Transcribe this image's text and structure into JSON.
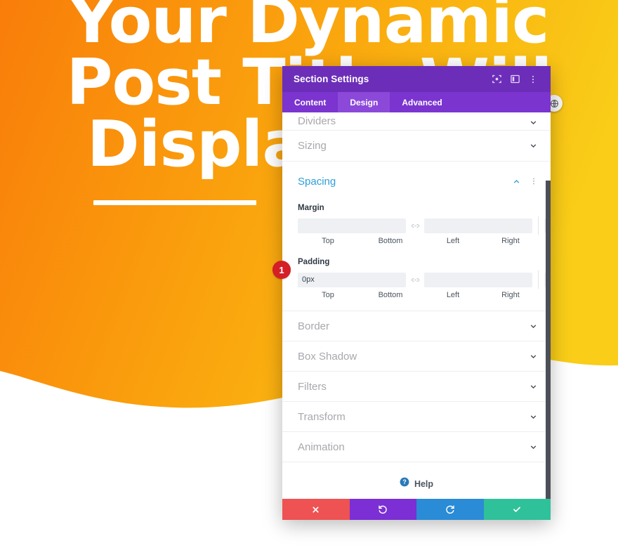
{
  "hero": {
    "lines": [
      "Your Dynamic",
      "Post Title Will",
      "Display Here"
    ],
    "rule": "horizontal-rule",
    "gradient": {
      "from": "#f97d0a",
      "to": "#f9cd18"
    }
  },
  "panel": {
    "title": "Section Settings",
    "header_icons": [
      {
        "name": "focus-icon",
        "glyph": "focus"
      },
      {
        "name": "layout-panel-icon",
        "glyph": "panel"
      },
      {
        "name": "more-vertical-icon",
        "glyph": "dots"
      }
    ],
    "tabs": [
      {
        "label": "Content",
        "active": false
      },
      {
        "label": "Design",
        "active": true
      },
      {
        "label": "Advanced",
        "active": false
      }
    ],
    "sections": [
      {
        "label": "Dividers",
        "state": "collapsed",
        "clipped": true
      },
      {
        "label": "Sizing",
        "state": "collapsed",
        "clipped": false
      },
      {
        "label": "Spacing",
        "state": "expanded",
        "clipped": false
      },
      {
        "label": "Border",
        "state": "collapsed",
        "clipped": false
      },
      {
        "label": "Box Shadow",
        "state": "collapsed",
        "clipped": false
      },
      {
        "label": "Filters",
        "state": "collapsed",
        "clipped": false
      },
      {
        "label": "Transform",
        "state": "collapsed",
        "clipped": false
      },
      {
        "label": "Animation",
        "state": "collapsed",
        "clipped": false
      }
    ],
    "spacing": {
      "margin": {
        "group_label": "Margin",
        "fields": [
          {
            "caption": "Top",
            "value": "",
            "placeholder": ""
          },
          {
            "caption": "Bottom",
            "value": "",
            "placeholder": ""
          },
          {
            "caption": "Left",
            "value": "",
            "placeholder": ""
          },
          {
            "caption": "Right",
            "value": "",
            "placeholder": ""
          }
        ]
      },
      "padding": {
        "group_label": "Padding",
        "fields": [
          {
            "caption": "Top",
            "value": "0px",
            "placeholder": ""
          },
          {
            "caption": "Bottom",
            "value": "",
            "placeholder": ""
          },
          {
            "caption": "Left",
            "value": "",
            "placeholder": ""
          },
          {
            "caption": "Right",
            "value": "",
            "placeholder": ""
          }
        ]
      }
    },
    "badge": {
      "number": "1",
      "color": "#d41f26"
    },
    "help": {
      "label": "Help",
      "icon": "help-circle-icon"
    },
    "footer_buttons": [
      {
        "name": "cancel-button",
        "icon": "close-icon",
        "color": "#ee5252"
      },
      {
        "name": "undo-button",
        "icon": "undo-icon",
        "color": "#7b2fd4"
      },
      {
        "name": "redo-button",
        "icon": "redo-icon",
        "color": "#2a8bd6"
      },
      {
        "name": "save-button",
        "icon": "checkmark-icon",
        "color": "#2fc19a"
      }
    ],
    "colors": {
      "header": "#6c2eb9",
      "tabbar": "#7b34cf",
      "tab_active": "#8c49d9",
      "accent": "#2d9fd9"
    }
  }
}
